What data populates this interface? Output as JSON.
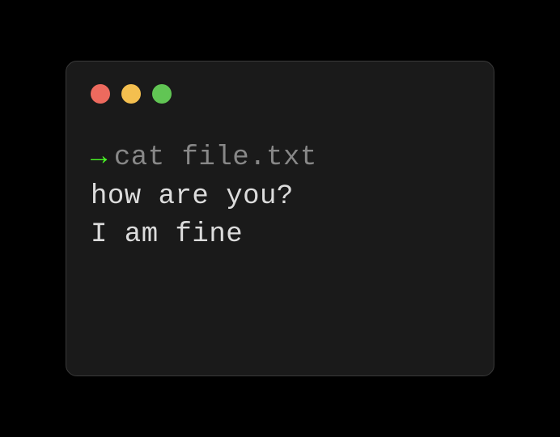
{
  "terminal": {
    "prompt_symbol": "→",
    "command": "cat file.txt",
    "output_lines": [
      "how are you?",
      "I am fine"
    ]
  },
  "colors": {
    "traffic_red": "#ed6a5e",
    "traffic_yellow": "#f4bf4f",
    "traffic_green": "#61c554"
  }
}
